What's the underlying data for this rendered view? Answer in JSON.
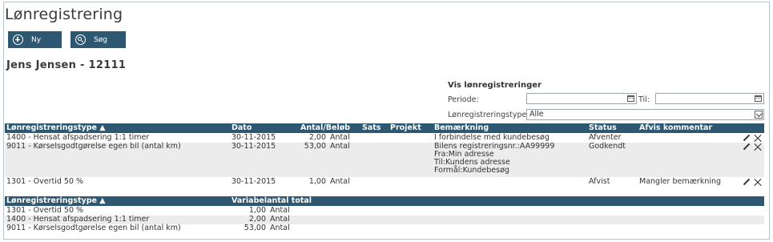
{
  "page": {
    "title": "Lønregistrering"
  },
  "toolbar": {
    "new_label": "Ny",
    "search_label": "Søg"
  },
  "person": "Jens Jensen - 12111",
  "filters": {
    "title": "Vis lønregistreringer",
    "period_label": "Periode:",
    "to_label": "Til:",
    "type_label": "Lønregistreringstype:",
    "type_value": "Alle"
  },
  "table1": {
    "headers": {
      "type": "Lønregistreringstype ▲",
      "date": "Dato",
      "amount": "Antal/Beløb",
      "rate": "Sats",
      "project": "Projekt",
      "remark": "Bemærkning",
      "status": "Status",
      "reject_comment": "Afvis kommentar"
    },
    "rows": [
      {
        "type": "1400 - Hensat afspadsering 1:1 timer",
        "date": "30-11-2015",
        "amount": "2,00",
        "unit": "Antal",
        "remark": [
          "I forbindelse med kundebesøg"
        ],
        "status": "Afventer",
        "reject_comment": ""
      },
      {
        "type": "9011 - Kørselsgodtgørelse egen bil (antal km)",
        "date": "30-11-2015",
        "amount": "53,00",
        "unit": "Antal",
        "remark": [
          "Bilens registreringsnr.:AA99999",
          "Fra:Min adresse",
          "Til:Kundens adresse",
          "Formål:Kundebesøg"
        ],
        "status": "Godkendt",
        "reject_comment": ""
      },
      {
        "type": "1301 - Overtid 50 %",
        "date": "30-11-2015",
        "amount": "1,00",
        "unit": "Antal",
        "remark": [
          ""
        ],
        "status": "Afvist",
        "reject_comment": "Mangler bemærkning"
      }
    ]
  },
  "table2": {
    "headers": {
      "type": "Lønregistreringstype ▲",
      "total": "Variabelantal total"
    },
    "rows": [
      {
        "type": "1301 - Overtid 50 %",
        "total": "1,00",
        "unit": "Antal"
      },
      {
        "type": "1400 - Hensat afspadsering 1:1 timer",
        "total": "2,00",
        "unit": "Antal"
      },
      {
        "type": "9011 - Kørselsgodtgørelse egen bil (antal km)",
        "total": "53,00",
        "unit": "Antal"
      }
    ]
  }
}
